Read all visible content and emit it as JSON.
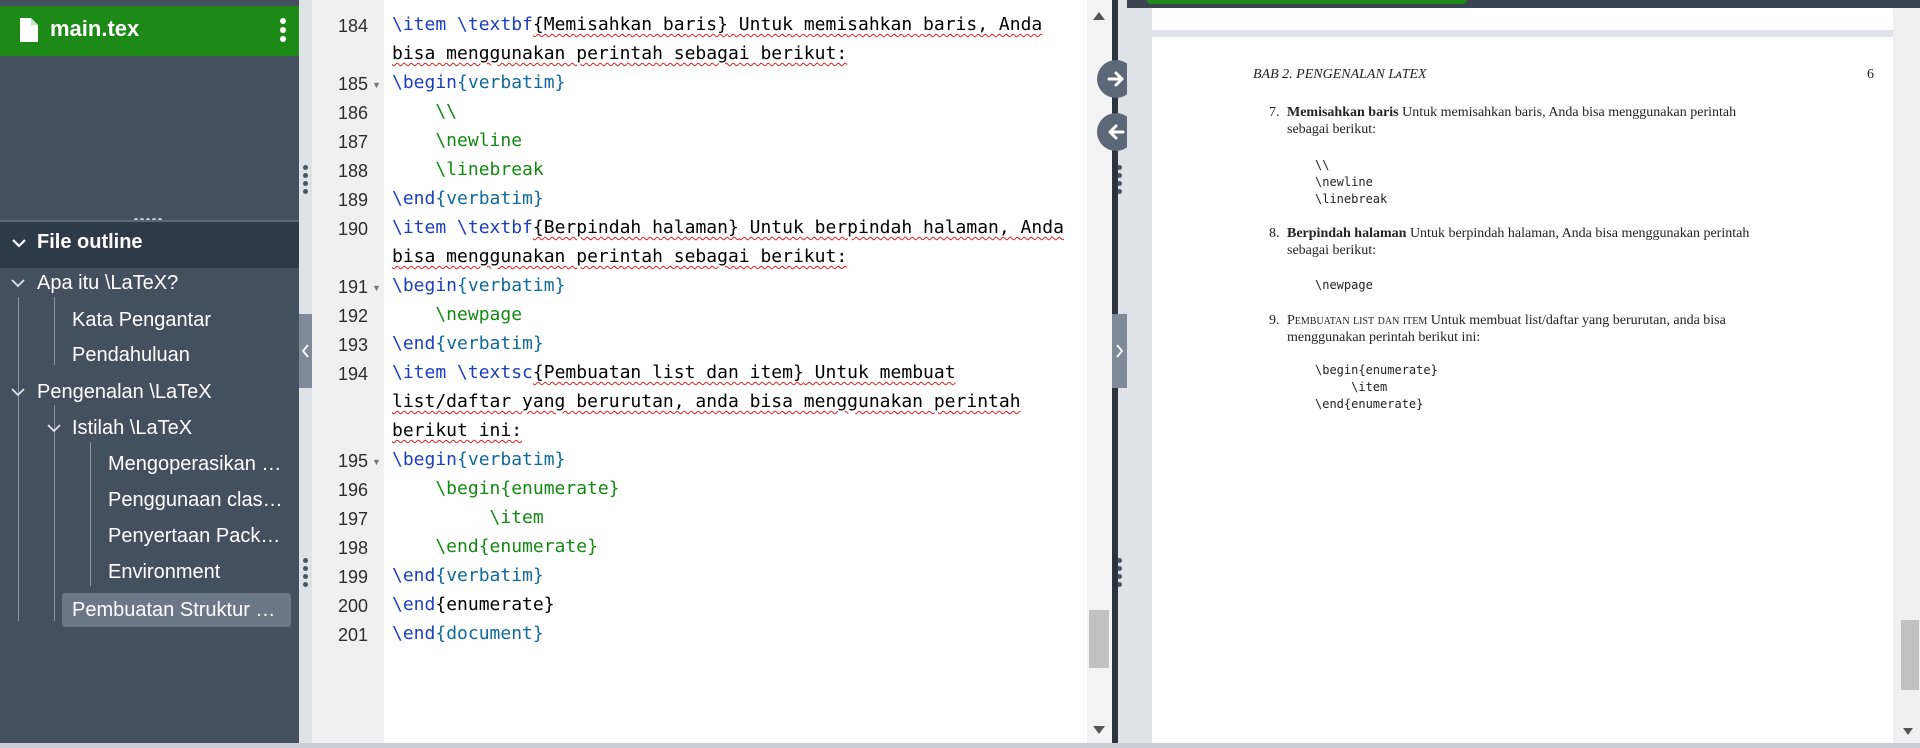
{
  "file": {
    "name": "main.tex"
  },
  "outline": {
    "header": "File outline",
    "items": [
      {
        "label": "Apa itu \\LaTeX?"
      },
      {
        "label": "Kata Pengantar"
      },
      {
        "label": "Pendahuluan"
      },
      {
        "label": "Pengenalan \\LaTeX"
      },
      {
        "label": "Istilah \\LaTeX"
      },
      {
        "label": "Mengoperasikan …"
      },
      {
        "label": "Penggunaan clas…"
      },
      {
        "label": "Penyertaan Pack…"
      },
      {
        "label": "Environment"
      },
      {
        "label": "Pembuatan Struktur …"
      }
    ]
  },
  "editor": {
    "line_numbers": [
      "184",
      "185",
      "186",
      "187",
      "188",
      "189",
      "190",
      "191",
      "192",
      "193",
      "194",
      "195",
      "196",
      "197",
      "198",
      "199",
      "200",
      "201"
    ],
    "code": {
      "l184a_cmd": "\\item \\textbf",
      "l184a_arg": "{Memisahkan baris}",
      "l184a_rest": " Untuk memisahkan baris, Anda",
      "l184b": "bisa menggunakan perintah sebagai berikut:",
      "l185_cmd": "\\begin",
      "l185_env": "{verbatim}",
      "l186": "    \\\\",
      "l187": "    \\newline",
      "l188": "    \\linebreak",
      "l189_cmd": "\\end",
      "l189_env": "{verbatim}",
      "l190a_cmd": "\\item \\textbf",
      "l190a_arg": "{Berpindah halaman}",
      "l190a_rest": " Untuk berpindah halaman, Anda",
      "l190b": "bisa menggunakan perintah sebagai berikut:",
      "l191_cmd": "\\begin",
      "l191_env": "{verbatim}",
      "l192": "    \\newpage",
      "l193_cmd": "\\end",
      "l193_env": "{verbatim}",
      "l194a_cmd": "\\item \\textsc",
      "l194a_arg": "{Pembuatan list dan item}",
      "l194a_rest": " Untuk membuat",
      "l194b": "list/daftar yang berurutan, anda bisa menggunakan perintah",
      "l194c": "berikut ini:",
      "l195_cmd": "\\begin",
      "l195_env": "{verbatim}",
      "l196": "    \\begin{enumerate}",
      "l197": "         \\item",
      "l198": "    \\end{enumerate}",
      "l199_cmd": "\\end",
      "l199_env": "{verbatim}",
      "l200_cmd": "\\end",
      "l200_env": "{enumerate}",
      "l201_cmd": "\\end",
      "l201_env": "{document}"
    }
  },
  "pdf": {
    "header_left": "BAB 2.  PENGENALAN LᴀTEX",
    "page_number": "6",
    "items": [
      {
        "num": "7.",
        "title": "Memisahkan baris",
        "text1": " Untuk memisahkan baris, Anda bisa menggunakan perintah",
        "text2": "sebagai berikut:",
        "code": "\\\\\n\\newline\n\\linebreak"
      },
      {
        "num": "8.",
        "title": "Berpindah halaman",
        "text1": " Untuk berpindah halaman, Anda bisa menggunakan perintah",
        "text2": "sebagai berikut:",
        "code": "\\newpage"
      },
      {
        "num": "9.",
        "title": "Pembuatan list dan item",
        "text1": " Untuk membuat list/daftar yang berurutan, anda bisa",
        "text2": "menggunakan perintah berikut ini:",
        "code": "\\begin{enumerate}\n     \\item\n\\end{enumerate}"
      }
    ]
  },
  "colors": {
    "header_green": "#1d8a17",
    "sidebar": "#45505f",
    "command": "#1a3ec0",
    "environment": "#0f6a9a",
    "verbatim": "#128a12"
  },
  "icons": [
    "file-icon",
    "kebab-menu-icon",
    "chevron-down-icon",
    "arrow-right-circle-icon",
    "arrow-left-circle-icon",
    "collapse-left-icon",
    "collapse-right-icon"
  ]
}
